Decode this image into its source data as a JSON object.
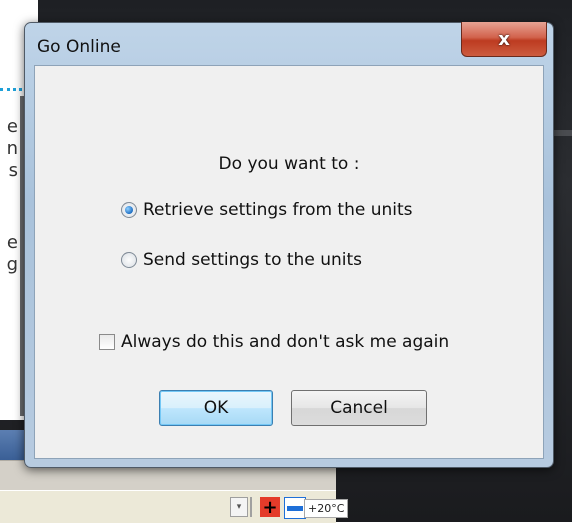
{
  "dialog": {
    "title": "Go Online",
    "close_glyph": "x",
    "question": "Do you want to :",
    "options": [
      {
        "label": "Retrieve settings from the units",
        "checked": true
      },
      {
        "label": "Send settings to the units",
        "checked": false
      }
    ],
    "always_checkbox": {
      "label": "Always do this and don't ask me again",
      "checked": false
    },
    "ok_label": "OK",
    "cancel_label": "Cancel"
  },
  "background": {
    "side_text_fragments": [
      "e",
      "n",
      "s",
      "e",
      "g",
      ""
    ],
    "toolbar": {
      "temperature": "+20°C",
      "plus_glyph": "+",
      "dropdown_glyph": "▾"
    }
  },
  "colors": {
    "arrow": "#1ea0d8",
    "close_button": "#c7432a",
    "dialog_frame": "#b7cbe0"
  },
  "icons": [
    "close-icon",
    "arrow-icon",
    "grid-icon",
    "plus-icon",
    "minus-icon"
  ]
}
